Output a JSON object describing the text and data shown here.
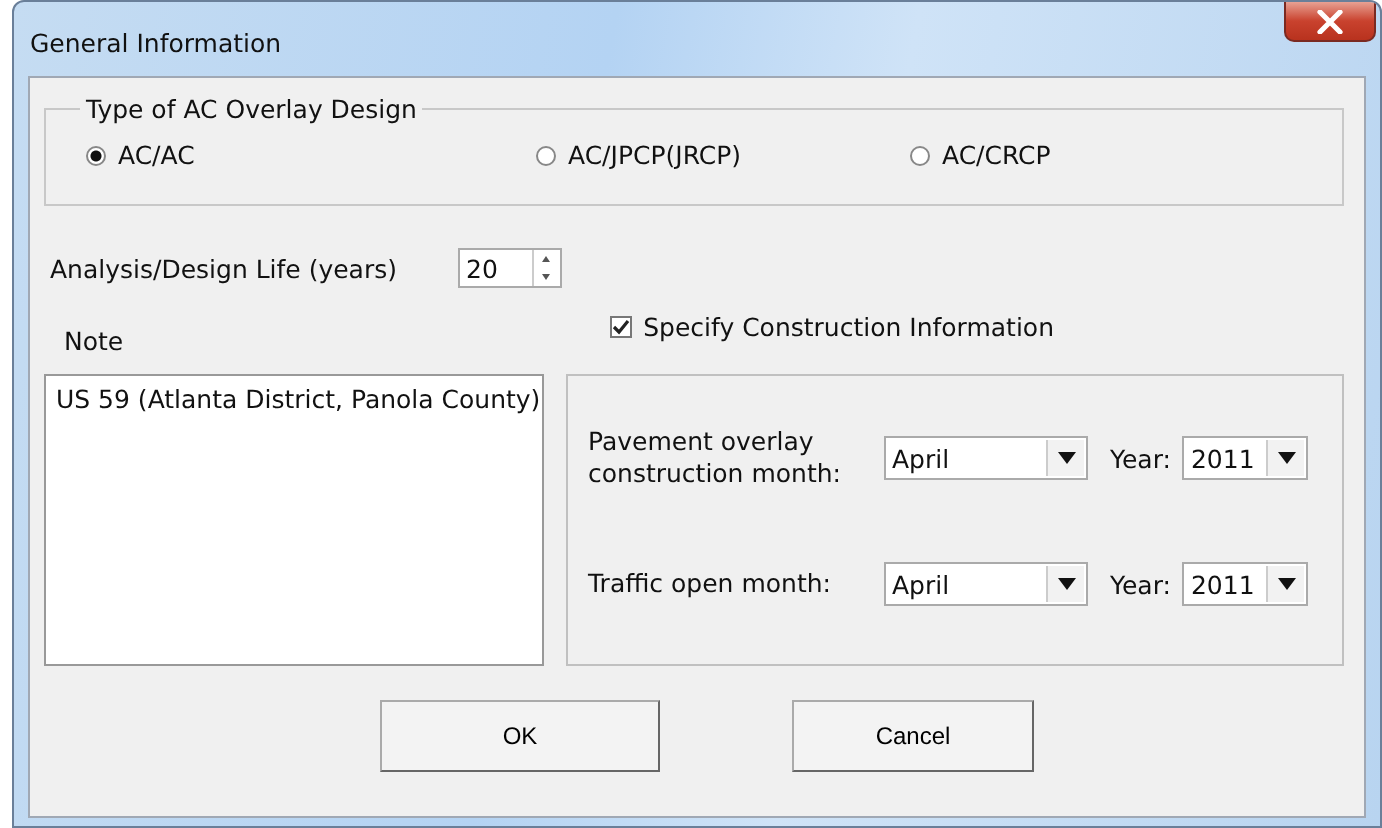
{
  "window": {
    "title": "General Information"
  },
  "design_type": {
    "title": "Type of AC Overlay Design",
    "options": [
      {
        "label": "AC/AC",
        "selected": true
      },
      {
        "label": "AC/JPCP(JRCP)",
        "selected": false
      },
      {
        "label": "AC/CRCP",
        "selected": false
      }
    ]
  },
  "design_life": {
    "label": "Analysis/Design Life (years)",
    "value": "20"
  },
  "construction_info": {
    "label": "Specify Construction Information",
    "checked": true
  },
  "note": {
    "label": "Note",
    "value": "US 59 (Atlanta District, Panola County)"
  },
  "construction_fields": [
    {
      "label": "Pavement overlay construction month:",
      "month": "April",
      "year_label": "Year:",
      "year": "2011"
    },
    {
      "label": "Traffic open month:",
      "month": "April",
      "year_label": "Year:",
      "year": "2011"
    }
  ],
  "buttons": [
    "OK",
    "Cancel"
  ]
}
